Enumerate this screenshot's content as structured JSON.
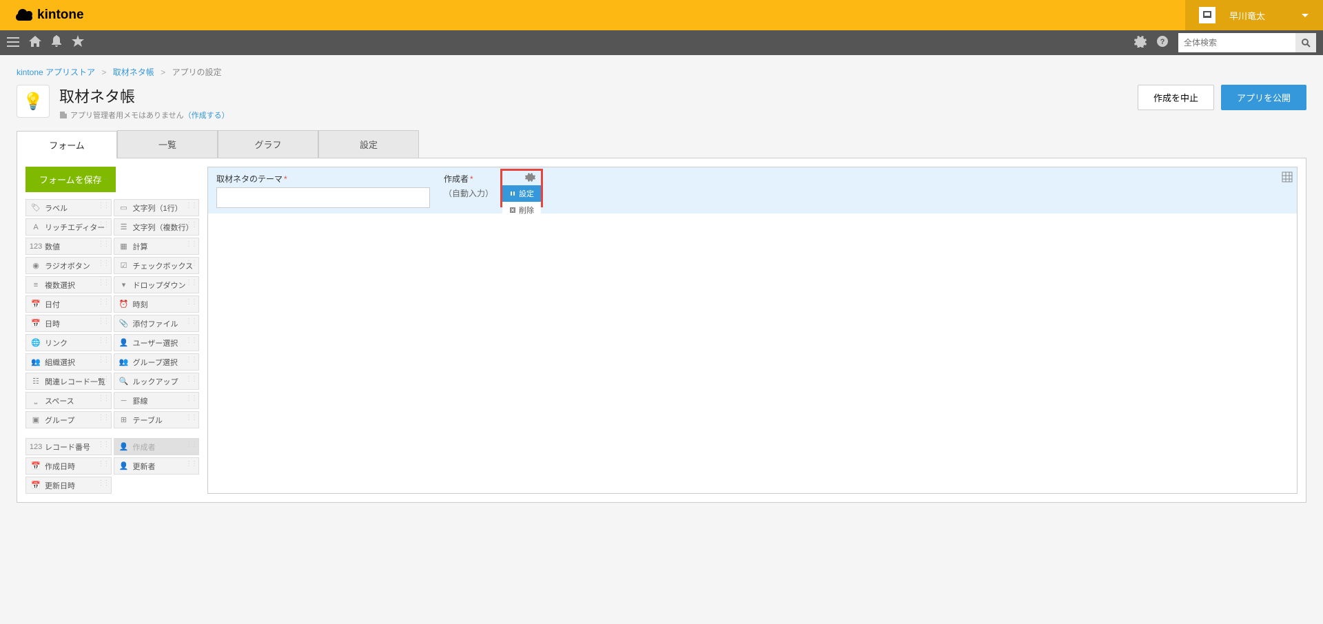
{
  "brand": "kintone",
  "user": {
    "name": "早川竜太"
  },
  "search": {
    "placeholder": "全体検索"
  },
  "breadcrumb": {
    "a": "kintone アプリストア",
    "b": "取材ネタ帳",
    "c": "アプリの設定"
  },
  "app": {
    "title": "取材ネタ帳",
    "memo_prefix": "アプリ管理者用メモはありません",
    "memo_link": "（作成する）"
  },
  "actions": {
    "cancel": "作成を中止",
    "publish": "アプリを公開"
  },
  "tabs": {
    "form": "フォーム",
    "list": "一覧",
    "graph": "グラフ",
    "settings": "設定"
  },
  "save_form": "フォームを保存",
  "fields": {
    "label": "ラベル",
    "text1": "文字列（1行）",
    "rich": "リッチエディター",
    "textm": "文字列（複数行）",
    "number": "数値",
    "calc": "計算",
    "radio": "ラジオボタン",
    "checkbox": "チェックボックス",
    "multi": "複数選択",
    "dropdown": "ドロップダウン",
    "date": "日付",
    "time": "時刻",
    "datetime": "日時",
    "attach": "添付ファイル",
    "link": "リンク",
    "user": "ユーザー選択",
    "org": "組織選択",
    "group": "グループ選択",
    "related": "関連レコード一覧",
    "lookup": "ルックアップ",
    "space": "スペース",
    "border": "罫線",
    "group2": "グループ",
    "table": "テーブル",
    "recnum": "レコード番号",
    "creator": "作成者",
    "created": "作成日時",
    "updater": "更新者",
    "updated": "更新日時"
  },
  "canvas": {
    "theme_label": "取材ネタのテーマ",
    "creator_label": "作成者",
    "auto_input": "（自動入力）"
  },
  "menu": {
    "settings": "設定",
    "delete": "削除"
  }
}
